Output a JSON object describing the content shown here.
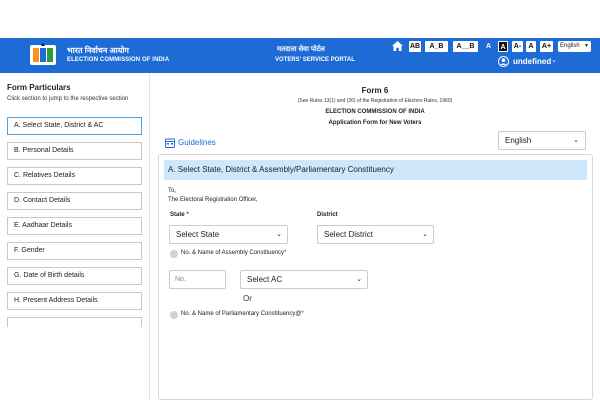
{
  "header": {
    "eci_hindi": "भारत निर्वाचन आयोग",
    "eci_english": "ELECTION COMMISSION OF INDIA",
    "portal_hindi": "मतदाता सेवा पोर्टल",
    "portal_english": "VOTERS' SERVICE PORTAL",
    "contrast_buttons": [
      "AB",
      "A_B",
      "A__B"
    ],
    "font_buttons": [
      "A",
      "A",
      "A-",
      "A",
      "A+"
    ],
    "language": "English",
    "user_name": "undefined",
    "colors": {
      "header_bg": "#1e6bd6",
      "active_border": "#4da3e6",
      "section_bg": "#cfe7fb",
      "required": "#d0021b"
    }
  },
  "sidebar": {
    "title": "Form Particulars",
    "subtitle": "Click section to jump to the respective section",
    "items": [
      "A. Select State, District & AC",
      "B. Personal Details",
      "C. Relatives Details",
      "D. Contact Details",
      "E. Aadhaar Details",
      "F. Gender",
      "G. Date of Birth details",
      "H. Present Address Details"
    ]
  },
  "form": {
    "title": "Form 6",
    "rules": "(See Rules 13(1) and (26) of the Registration of Electors Rules, 1960)",
    "commission": "ELECTION COMMISSION OF INDIA",
    "subtitle": "Application Form for New Voters",
    "guidelines": "Guidelines",
    "language_select": "English",
    "section_a": {
      "heading": "A. Select State, District & Assembly/Parliamentary Constituency",
      "to": "To,",
      "officer": "The Electoral Registration Officer,",
      "state_label": "State",
      "state_value": "Select State",
      "district_label": "District",
      "district_value": "Select District",
      "ac_radio_label": "No. & Name of Assembly Constituency",
      "ac_no_placeholder": "No.",
      "ac_select": "Select AC",
      "or": "Or",
      "pc_radio_label": "No. & Name of Parliamentary Constituency@",
      "required_mark": "*"
    }
  }
}
